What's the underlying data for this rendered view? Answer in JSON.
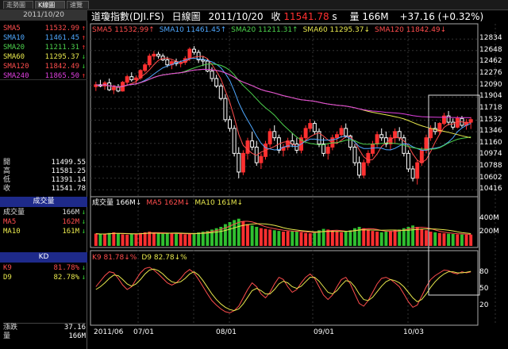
{
  "tabs": [
    "走勢圖",
    "K線圖",
    "速覽"
  ],
  "left": {
    "date": "2011/10/20",
    "ma": [
      {
        "label": "SMA5",
        "value": "11532.99",
        "color": "#ff4d4d",
        "arrow": "↑"
      },
      {
        "label": "SMA10",
        "value": "11461.45",
        "color": "#4fa8ff",
        "arrow": "↑"
      },
      {
        "label": "SMA20",
        "value": "11211.31",
        "color": "#4dd24d",
        "arrow": "↑"
      },
      {
        "label": "SMA60",
        "value": "11295.37",
        "color": "#e8e84d",
        "arrow": "↓"
      },
      {
        "label": "SMA120",
        "value": "11842.49",
        "color": "#ff4d4d",
        "arrow": "↓"
      },
      {
        "label": "SMA240",
        "value": "11865.50",
        "color": "#e040e0",
        "arrow": "↑"
      }
    ],
    "ohlc": [
      {
        "label": "開",
        "value": "11499.55"
      },
      {
        "label": "高",
        "value": "11581.25"
      },
      {
        "label": "低",
        "value": "11391.14"
      },
      {
        "label": "收",
        "value": "11541.78"
      }
    ],
    "volume_header": "成交量",
    "volume": [
      {
        "label": "成交量",
        "value": "166M",
        "color": "#ddd",
        "arrow": "↓"
      },
      {
        "label": "MA5",
        "value": "162M",
        "color": "#ff4d4d",
        "arrow": "↓"
      },
      {
        "label": "MA10",
        "value": "161M",
        "color": "#e8e84d",
        "arrow": "↓"
      }
    ],
    "kd_header": "KD",
    "kd": [
      {
        "label": "K9",
        "value": "81.78%",
        "color": "#ff4d4d",
        "arrow": "↓"
      },
      {
        "label": "D9",
        "value": "82.78%",
        "color": "#e8e84d",
        "arrow": "↓"
      }
    ],
    "change": {
      "label": "漲跌",
      "value": "37.16"
    },
    "vol_total": {
      "label": "量",
      "value": "166M"
    }
  },
  "header": {
    "name": "道瓊指數(DJI.FS)",
    "period": "日線圖",
    "date": "2011/10/20",
    "close_label": "收",
    "close": "11541.78",
    "close_suffix": "s",
    "vol_label": "量",
    "vol": "166M",
    "change": "+37.16 (+0.32%)"
  },
  "legends": {
    "price": [
      {
        "text": "SMA5 11532.99↑",
        "color": "#ff4d4d"
      },
      {
        "text": "SMA10 11461.45↑",
        "color": "#4fa8ff"
      },
      {
        "text": "SMA20 11211.31↑",
        "color": "#4dd24d"
      },
      {
        "text": "SMA60 11295.37↓",
        "color": "#e8e84d"
      },
      {
        "text": "SMA120 11842.49↓",
        "color": "#ff4d4d"
      }
    ],
    "volume": [
      {
        "text": "成交量 166M↓",
        "color": "#ffffff"
      },
      {
        "text": "MA5 162M↓",
        "color": "#ff4d4d"
      },
      {
        "text": "MA10 161M↓",
        "color": "#e8e84d"
      }
    ],
    "kd": [
      {
        "text": "K9 81.78↓%",
        "color": "#ff4d4d"
      },
      {
        "text": "D9 82.78↓%",
        "color": "#e8e84d"
      }
    ]
  },
  "axes": {
    "price_ticks": [
      "12834",
      "12648",
      "12462",
      "12276",
      "12090",
      "11904",
      "11718",
      "11532",
      "11346",
      "11160",
      "10974",
      "10788",
      "10602",
      "10416"
    ],
    "price_range": [
      10330,
      12900
    ],
    "volume_ticks": [
      "400M",
      "200M"
    ],
    "volume_range": [
      0,
      560
    ],
    "kd_ticks": [
      "80",
      "50",
      "20"
    ],
    "kd_range": [
      0,
      100
    ],
    "x_labels": [
      "2011/06",
      "07/01",
      "08/01",
      "09/01",
      "10/03"
    ]
  },
  "chart_data": {
    "type": "candlestick",
    "note_dates_first": "2011/06",
    "up_color": "#ff3030",
    "down_color": "#ffffff",
    "candles": [
      [
        12070,
        12150,
        12000,
        12100
      ],
      [
        12100,
        12180,
        12060,
        12080
      ],
      [
        12080,
        12160,
        12020,
        12130
      ],
      [
        12130,
        12200,
        12000,
        12020
      ],
      [
        12020,
        12100,
        11950,
        12060
      ],
      [
        12060,
        12110,
        11980,
        12000
      ],
      [
        12000,
        12160,
        11990,
        12140
      ],
      [
        12140,
        12260,
        12100,
        12230
      ],
      [
        12230,
        12300,
        12150,
        12180
      ],
      [
        12180,
        12250,
        12100,
        12210
      ],
      [
        12210,
        12350,
        12180,
        12330
      ],
      [
        12330,
        12450,
        12300,
        12420
      ],
      [
        12420,
        12600,
        12380,
        12560
      ],
      [
        12560,
        12640,
        12500,
        12590
      ],
      [
        12590,
        12630,
        12520,
        12560
      ],
      [
        12560,
        12600,
        12480,
        12500
      ],
      [
        12500,
        12550,
        12380,
        12420
      ],
      [
        12420,
        12500,
        12350,
        12470
      ],
      [
        12470,
        12520,
        12400,
        12440
      ],
      [
        12440,
        12490,
        12380,
        12460
      ],
      [
        12460,
        12560,
        12420,
        12520
      ],
      [
        12520,
        12700,
        12480,
        12670
      ],
      [
        12670,
        12720,
        12580,
        12620
      ],
      [
        12620,
        12660,
        12450,
        12500
      ],
      [
        12500,
        12560,
        12400,
        12480
      ],
      [
        12480,
        12520,
        12300,
        12320
      ],
      [
        12320,
        12380,
        12150,
        12200
      ],
      [
        12200,
        12260,
        12050,
        12080
      ],
      [
        12080,
        12120,
        11850,
        11880
      ],
      [
        11880,
        11950,
        11500,
        11540
      ],
      [
        11540,
        11600,
        11350,
        11400
      ],
      [
        11400,
        11450,
        10950,
        11000
      ],
      [
        11000,
        11100,
        10600,
        10700
      ],
      [
        10700,
        11050,
        10650,
        11000
      ],
      [
        11000,
        11250,
        10900,
        11200
      ],
      [
        11200,
        11350,
        11050,
        11100
      ],
      [
        11100,
        11200,
        10800,
        10850
      ],
      [
        10850,
        11000,
        10750,
        10950
      ],
      [
        10950,
        11200,
        10900,
        11150
      ],
      [
        11150,
        11400,
        11100,
        11350
      ],
      [
        11350,
        11450,
        11200,
        11250
      ],
      [
        11250,
        11300,
        11000,
        11050
      ],
      [
        11050,
        11150,
        10950,
        11100
      ],
      [
        11100,
        11250,
        11050,
        11200
      ],
      [
        11200,
        11320,
        11100,
        11150
      ],
      [
        11150,
        11250,
        11000,
        11050
      ],
      [
        11050,
        11300,
        11000,
        11250
      ],
      [
        11250,
        11450,
        11200,
        11400
      ],
      [
        11400,
        11550,
        11350,
        11480
      ],
      [
        11480,
        11520,
        11300,
        11350
      ],
      [
        11350,
        11400,
        11100,
        11150
      ],
      [
        11150,
        11250,
        10950,
        11000
      ],
      [
        11000,
        11150,
        10900,
        11100
      ],
      [
        11100,
        11300,
        11050,
        11250
      ],
      [
        11250,
        11350,
        11150,
        11300
      ],
      [
        11300,
        11450,
        11250,
        11400
      ],
      [
        11400,
        11480,
        11250,
        11280
      ],
      [
        11280,
        11300,
        11050,
        11100
      ],
      [
        11100,
        11150,
        10800,
        10850
      ],
      [
        10850,
        10950,
        10600,
        10650
      ],
      [
        10650,
        10900,
        10600,
        10850
      ],
      [
        10850,
        11050,
        10800,
        11000
      ],
      [
        11000,
        11200,
        10950,
        11150
      ],
      [
        11150,
        11350,
        11100,
        11300
      ],
      [
        11300,
        11400,
        11200,
        11250
      ],
      [
        11250,
        11350,
        11100,
        11150
      ],
      [
        11150,
        11300,
        11050,
        11250
      ],
      [
        11250,
        11400,
        11150,
        11350
      ],
      [
        11350,
        11420,
        11200,
        11250
      ],
      [
        11250,
        11300,
        10950,
        11000
      ],
      [
        11000,
        11050,
        10700,
        10750
      ],
      [
        10750,
        10800,
        10550,
        10600
      ],
      [
        10600,
        10900,
        10500,
        10850
      ],
      [
        10850,
        11100,
        10800,
        11050
      ],
      [
        11050,
        11300,
        11000,
        11250
      ],
      [
        11250,
        11450,
        11200,
        11400
      ],
      [
        11400,
        11500,
        11300,
        11350
      ],
      [
        11350,
        11500,
        11300,
        11480
      ],
      [
        11480,
        11650,
        11450,
        11600
      ],
      [
        11600,
        11680,
        11450,
        11500
      ],
      [
        11500,
        11560,
        11380,
        11420
      ],
      [
        11420,
        11600,
        11400,
        11560
      ],
      [
        11560,
        11600,
        11420,
        11450
      ],
      [
        11450,
        11550,
        11380,
        11500
      ],
      [
        11500,
        11581,
        11391,
        11542
      ]
    ],
    "volume": [
      180,
      170,
      175,
      190,
      200,
      185,
      170,
      165,
      175,
      180,
      190,
      200,
      210,
      195,
      180,
      175,
      185,
      190,
      180,
      175,
      170,
      180,
      190,
      200,
      210,
      220,
      240,
      260,
      280,
      320,
      350,
      380,
      400,
      360,
      320,
      300,
      280,
      260,
      250,
      240,
      230,
      220,
      210,
      215,
      220,
      210,
      200,
      190,
      185,
      200,
      230,
      250,
      240,
      220,
      210,
      200,
      210,
      230,
      260,
      280,
      260,
      240,
      220,
      210,
      200,
      210,
      220,
      230,
      240,
      260,
      280,
      300,
      280,
      250,
      230,
      210,
      200,
      190,
      185,
      180,
      175,
      170,
      168,
      165,
      166
    ],
    "k9": [
      55,
      65,
      75,
      82,
      80,
      70,
      58,
      50,
      55,
      68,
      80,
      88,
      90,
      85,
      78,
      70,
      62,
      58,
      62,
      70,
      80,
      86,
      80,
      68,
      55,
      42,
      30,
      22,
      15,
      10,
      8,
      12,
      20,
      35,
      50,
      62,
      55,
      42,
      35,
      45,
      60,
      72,
      68,
      55,
      45,
      50,
      62,
      72,
      78,
      70,
      55,
      40,
      32,
      40,
      55,
      68,
      72,
      60,
      42,
      25,
      20,
      30,
      45,
      60,
      70,
      72,
      68,
      62,
      55,
      42,
      28,
      18,
      22,
      38,
      55,
      68,
      75,
      80,
      85,
      84,
      80,
      78,
      82,
      80,
      81.78
    ],
    "d9": [
      50,
      55,
      62,
      70,
      76,
      75,
      68,
      60,
      56,
      60,
      68,
      78,
      85,
      87,
      84,
      78,
      70,
      64,
      62,
      64,
      70,
      78,
      82,
      76,
      66,
      54,
      42,
      32,
      24,
      18,
      14,
      12,
      15,
      24,
      36,
      48,
      52,
      48,
      42,
      42,
      50,
      60,
      65,
      62,
      55,
      52,
      56,
      64,
      72,
      72,
      65,
      55,
      45,
      42,
      48,
      58,
      66,
      64,
      55,
      42,
      32,
      30,
      36,
      46,
      56,
      64,
      68,
      66,
      62,
      55,
      45,
      35,
      28,
      32,
      42,
      54,
      64,
      72,
      78,
      82,
      82,
      80,
      80,
      81,
      82.78
    ]
  }
}
